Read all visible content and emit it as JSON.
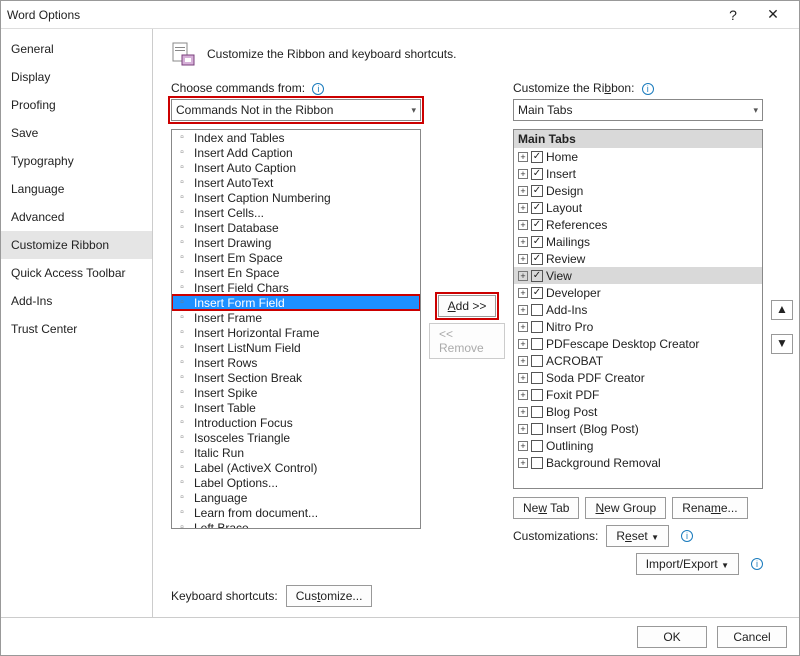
{
  "window": {
    "title": "Word Options"
  },
  "sidebar": {
    "items": [
      {
        "label": "General"
      },
      {
        "label": "Display"
      },
      {
        "label": "Proofing"
      },
      {
        "label": "Save"
      },
      {
        "label": "Typography"
      },
      {
        "label": "Language"
      },
      {
        "label": "Advanced"
      },
      {
        "label": "Customize Ribbon"
      },
      {
        "label": "Quick Access Toolbar"
      },
      {
        "label": "Add-Ins"
      },
      {
        "label": "Trust Center"
      }
    ],
    "selected_index": 7
  },
  "header": {
    "text": "Customize the Ribbon and keyboard shortcuts."
  },
  "left": {
    "label": "Choose commands from:",
    "dropdown_value": "Commands Not in the Ribbon",
    "kb_label": "Keyboard shortcuts:",
    "customize_btn": "Customize..."
  },
  "right": {
    "label": "Customize the Ribbon:",
    "dropdown_value": "Main Tabs",
    "tree_header": "Main Tabs",
    "newtab": "New Tab",
    "newgroup": "New Group",
    "rename": "Rename...",
    "customizations_label": "Customizations:",
    "reset": "Reset",
    "importexport": "Import/Export"
  },
  "mid": {
    "add": "Add >>",
    "remove": "<< Remove"
  },
  "commands": [
    "Index and Tables",
    "Insert Add Caption",
    "Insert Auto Caption",
    "Insert AutoText",
    "Insert Caption Numbering",
    "Insert Cells...",
    "Insert Database",
    "Insert Drawing",
    "Insert Em Space",
    "Insert En Space",
    "Insert Field Chars",
    "Insert Form Field",
    "Insert Frame",
    "Insert Horizontal Frame",
    "Insert ListNum Field",
    "Insert Rows",
    "Insert Section Break",
    "Insert Spike",
    "Insert Table",
    "Introduction Focus",
    "Isosceles Triangle",
    "Italic Run",
    "Label (ActiveX Control)",
    "Label Options...",
    "Language",
    "Learn from document...",
    "Left Brace"
  ],
  "commands_selected_index": 11,
  "tabs": [
    {
      "label": "Home",
      "checked": true
    },
    {
      "label": "Insert",
      "checked": true
    },
    {
      "label": "Design",
      "checked": true
    },
    {
      "label": "Layout",
      "checked": true
    },
    {
      "label": "References",
      "checked": true
    },
    {
      "label": "Mailings",
      "checked": true
    },
    {
      "label": "Review",
      "checked": true
    },
    {
      "label": "View",
      "checked": true,
      "selected": true
    },
    {
      "label": "Developer",
      "checked": true
    },
    {
      "label": "Add-Ins",
      "checked": false
    },
    {
      "label": "Nitro Pro",
      "checked": false
    },
    {
      "label": "PDFescape Desktop Creator",
      "checked": false
    },
    {
      "label": "ACROBAT",
      "checked": false
    },
    {
      "label": "Soda PDF Creator",
      "checked": false
    },
    {
      "label": "Foxit PDF",
      "checked": false
    },
    {
      "label": "Blog Post",
      "checked": false
    },
    {
      "label": "Insert (Blog Post)",
      "checked": false
    },
    {
      "label": "Outlining",
      "checked": false
    },
    {
      "label": "Background Removal",
      "checked": false
    }
  ],
  "footer": {
    "ok": "OK",
    "cancel": "Cancel"
  }
}
